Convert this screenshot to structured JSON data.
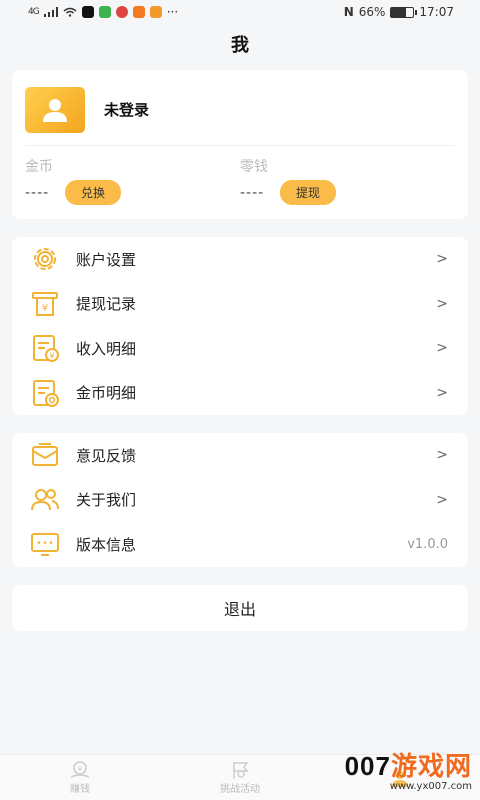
{
  "status_bar": {
    "signal": "4G",
    "battery_text": "66%",
    "battery_level": 0.66,
    "time": "17:07"
  },
  "header": {
    "title": "我"
  },
  "profile": {
    "login_text": "未登录",
    "coins": {
      "label": "金币",
      "value": "----",
      "button": "兑换"
    },
    "change": {
      "label": "零钱",
      "value": "----",
      "button": "提现"
    }
  },
  "menu_group_1": [
    {
      "label": "账户设置",
      "icon": "gear-icon",
      "arrow": ">"
    },
    {
      "label": "提现记录",
      "icon": "withdraw-receipt-icon",
      "arrow": ">"
    },
    {
      "label": "收入明细",
      "icon": "income-document-icon",
      "arrow": ">"
    },
    {
      "label": "金币明细",
      "icon": "coin-document-icon",
      "arrow": ">"
    }
  ],
  "menu_group_2": [
    {
      "label": "意见反馈",
      "icon": "feedback-envelope-icon",
      "arrow": ">"
    },
    {
      "label": "关于我们",
      "icon": "users-icon",
      "arrow": ">"
    },
    {
      "label": "版本信息",
      "icon": "monitor-icon",
      "version": "v1.0.0"
    }
  ],
  "logout": {
    "label": "退出"
  },
  "tabbar": {
    "tabs": [
      {
        "label": "赚钱",
        "icon": "earn-icon"
      },
      {
        "label": "挑战活动",
        "icon": "flag-icon"
      },
      {
        "label": "",
        "icon": "me-icon"
      }
    ]
  },
  "watermark": {
    "main_prefix": "007",
    "main_accent": "游戏网",
    "sub": "www.yx007.com"
  },
  "colors": {
    "accent": "#fbbb48",
    "icon_stroke": "#f2b233",
    "background": "#f5f6f8"
  }
}
